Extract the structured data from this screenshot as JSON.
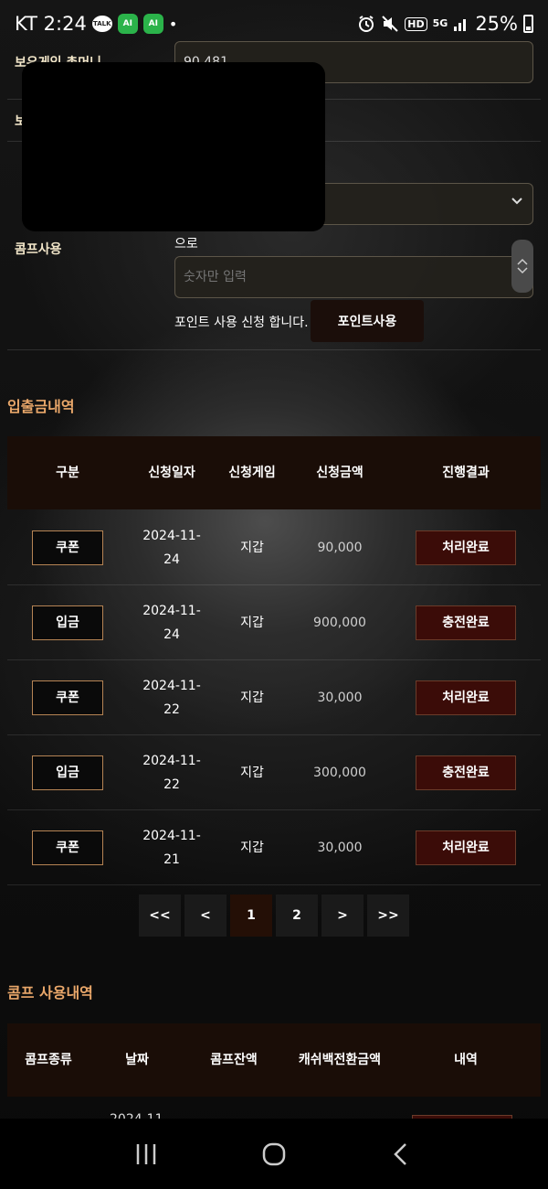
{
  "status_bar": {
    "carrier_time": "KT 2:24",
    "app_icons": [
      "talk-icon",
      "green-app-icon",
      "green-app-icon"
    ],
    "talk_text": "TALK",
    "green_text": "AI",
    "dot": "•",
    "hd": "HD",
    "network": "5G",
    "battery": "25%"
  },
  "form": {
    "balance_label": "보유게임 총머니",
    "balance_value": "90,481",
    "label2": "보",
    "comp_label": "콤프사용",
    "to_text": "으로",
    "input_placeholder": "숫자만 입력",
    "notice": "포인트 사용 신청 합니다.",
    "point_button": "포인트사용"
  },
  "history": {
    "title": "입출금내역",
    "headers": [
      "구분",
      "신청일자",
      "신청게임",
      "신청금액",
      "진행결과"
    ],
    "rows": [
      {
        "type": "쿠폰",
        "date": "2024-11-24",
        "game": "지갑",
        "amount": "90,000",
        "result": "처리완료"
      },
      {
        "type": "입금",
        "date": "2024-11-24",
        "game": "지갑",
        "amount": "900,000",
        "result": "충전완료"
      },
      {
        "type": "쿠폰",
        "date": "2024-11-22",
        "game": "지갑",
        "amount": "30,000",
        "result": "처리완료"
      },
      {
        "type": "입금",
        "date": "2024-11-22",
        "game": "지갑",
        "amount": "300,000",
        "result": "충전완료"
      },
      {
        "type": "쿠폰",
        "date": "2024-11-21",
        "game": "지갑",
        "amount": "30,000",
        "result": "처리완료"
      }
    ]
  },
  "pagination": {
    "first": "<<",
    "prev": "<",
    "pages": [
      "1",
      "2"
    ],
    "active_page": "1",
    "next": ">",
    "last": ">>"
  },
  "comp_history": {
    "title": "콤프 사용내역",
    "headers": [
      "콤프종류",
      "날짜",
      "콤프잔액",
      "캐쉬백전환금액",
      "내역"
    ],
    "peek_date": "2024-11"
  },
  "nav": {
    "icons": [
      "recent-apps-icon",
      "home-icon",
      "back-icon"
    ]
  }
}
